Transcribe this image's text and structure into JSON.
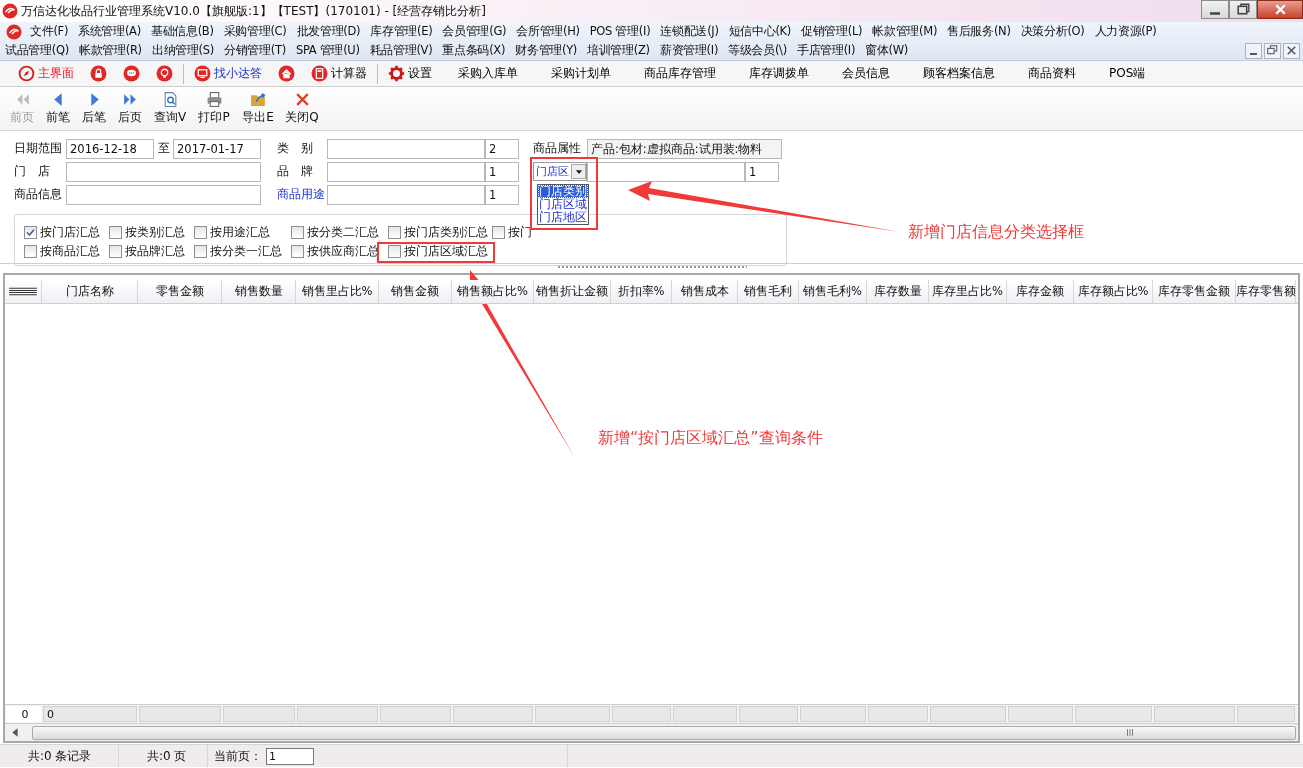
{
  "window": {
    "title": "万信达化妆品行业管理系统V10.0【旗舰版:1】【TEST】(170101) - [经营存销比分析]"
  },
  "menu_rows": [
    [
      "文件(F)",
      "系统管理(A)",
      "基础信息(B)",
      "采购管理(C)",
      "批发管理(D)",
      "库存管理(E)",
      "会员管理(G)",
      "会所管理(H)",
      "POS 管理(I)",
      "连锁配送(J)",
      "短信中心(K)",
      "促销管理(L)",
      "帐款管理(M)",
      "售后服务(N)",
      "决策分析(O)",
      "人力资源(P)"
    ],
    [
      "试品管理(Q)",
      "帐款管理(R)",
      "出纳管理(S)",
      "分销管理(T)",
      "SPA 管理(U)",
      "耗品管理(V)",
      "重点条码(X)",
      "财务管理(Y)",
      "培训管理(Z)",
      "薪资管理(I)",
      "等级会员(\\)",
      "手店管理(I)",
      "窗体(W)"
    ]
  ],
  "shortcut_bar": [
    {
      "kind": "compass",
      "label": "主界面"
    },
    {
      "kind": "lock"
    },
    {
      "kind": "chat"
    },
    {
      "kind": "bulb"
    },
    {
      "kind": "separator"
    },
    {
      "kind": "monitor",
      "label": "找小达答"
    },
    {
      "kind": "home"
    },
    {
      "kind": "calculator",
      "label": "计算器"
    },
    {
      "kind": "separator"
    },
    {
      "kind": "gear",
      "label": "设置"
    },
    {
      "kind": "text",
      "label": "采购入库单"
    },
    {
      "kind": "text",
      "label": "采购计划单"
    },
    {
      "kind": "text",
      "label": "商品库存管理"
    },
    {
      "kind": "text",
      "label": "库存调拨单"
    },
    {
      "kind": "text",
      "label": "会员信息"
    },
    {
      "kind": "text",
      "label": "顾客档案信息"
    },
    {
      "kind": "text",
      "label": "商品资料"
    },
    {
      "kind": "text",
      "label": "POS端"
    }
  ],
  "toolbar": [
    {
      "kind": "first",
      "label": "前页",
      "disabled": true
    },
    {
      "kind": "prev",
      "label": "前笔",
      "disabled": false
    },
    {
      "kind": "next",
      "label": "后笔",
      "disabled": false
    },
    {
      "kind": "last",
      "label": "后页",
      "disabled": false
    },
    {
      "kind": "query",
      "label": "查询V",
      "disabled": false
    },
    {
      "kind": "print",
      "label": "打印P",
      "disabled": false
    },
    {
      "kind": "export",
      "label": "导出E",
      "disabled": false
    },
    {
      "kind": "close",
      "label": "关闭Q",
      "disabled": false
    }
  ],
  "form": {
    "date_label": "日期范围",
    "date_from": "2016-12-18",
    "date_sep": "至",
    "date_to": "2017-01-17",
    "category_label": "类　别",
    "category_code": "2",
    "attribute_label": "商品属性",
    "attribute_value": "产品:包材:虚拟商品:试用装:物料",
    "store_label": "门　店",
    "brand_label": "品　牌",
    "brand_code": "1",
    "store_info_select": "门店区",
    "store_info_code": "1",
    "product_label": "商品信息",
    "usage_label": "商品用途",
    "usage_code": "1",
    "dropdown_options": [
      {
        "label": "门店类别",
        "selected": true
      },
      {
        "label": "门店区域",
        "selected": false
      },
      {
        "label": "门店地区",
        "selected": false
      }
    ]
  },
  "summary_options": [
    [
      {
        "label": "按门店汇总",
        "checked": true
      },
      {
        "label": "按类别汇总",
        "checked": false
      },
      {
        "label": "按用途汇总",
        "checked": false
      },
      {
        "label": "按分类二汇总",
        "checked": false
      },
      {
        "label": "按门店类别汇总",
        "checked": false
      },
      {
        "label": "按门",
        "checked": false
      }
    ],
    [
      {
        "label": "按商品汇总",
        "checked": false
      },
      {
        "label": "按品牌汇总",
        "checked": false
      },
      {
        "label": "按分类一汇总",
        "checked": false
      },
      {
        "label": "按供应商汇总",
        "checked": false
      },
      {
        "label": "按门店区域汇总",
        "checked": false
      }
    ]
  ],
  "table": {
    "columns": [
      "门店名称",
      "零售金额",
      "销售数量",
      "销售里占比%",
      "销售金额",
      "销售额占比%",
      "销售折让金额",
      "折扣率%",
      "销售成本",
      "销售毛利",
      "销售毛利%",
      "库存数量",
      "库存里占比%",
      "库存金额",
      "库存额占比%",
      "库存零售金额",
      "库存零售额"
    ],
    "footer_row_header": "0",
    "footer_first": "0"
  },
  "status_bar": {
    "records": "共:0 条记录",
    "pages": "共:0 页",
    "current_label": "当前页：",
    "current_page": "1"
  },
  "annotations": [
    {
      "text": "新增门店信息分类选择框"
    },
    {
      "text": "新增“按门店区域汇总”查询条件"
    }
  ]
}
